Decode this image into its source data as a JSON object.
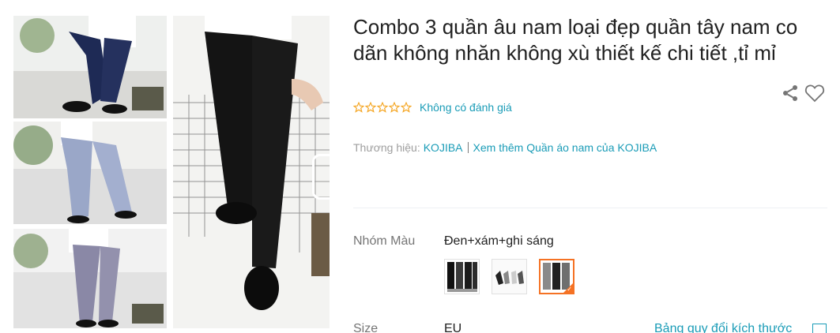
{
  "product": {
    "title": "Combo 3 quần âu nam loại đẹp quần tây nam co dãn không nhăn không xù thiết kế chi tiết ,tỉ mỉ",
    "rating_text": "Không có đánh giá",
    "brand_label": "Thương hiệu:",
    "brand_name": "KOJIBA",
    "more_link": "Xem thêm Quần áo nam của KOJIBA"
  },
  "gallery": {
    "thumbnails": [
      {
        "name": "navy trousers photo"
      },
      {
        "name": "light blue trousers photo"
      },
      {
        "name": "lavender gray trousers photo"
      }
    ],
    "main_image": "black trousers photo",
    "video_icon": "play-icon"
  },
  "actions": {
    "share_icon": "share-icon",
    "wishlist_icon": "heart-icon"
  },
  "variants": {
    "color_label": "Nhóm Màu",
    "color_value": "Đen+xám+ghi sáng",
    "swatches": [
      {
        "name": "swatch-1",
        "selected": false
      },
      {
        "name": "swatch-2",
        "selected": false
      },
      {
        "name": "swatch-3",
        "selected": true
      }
    ],
    "size_label": "Size",
    "size_value": "EU",
    "size_guide": "Bảng quy đổi kích thước"
  },
  "colors": {
    "link": "#1a9cb7",
    "accent": "#f57224",
    "star_empty": "#f5a623"
  }
}
